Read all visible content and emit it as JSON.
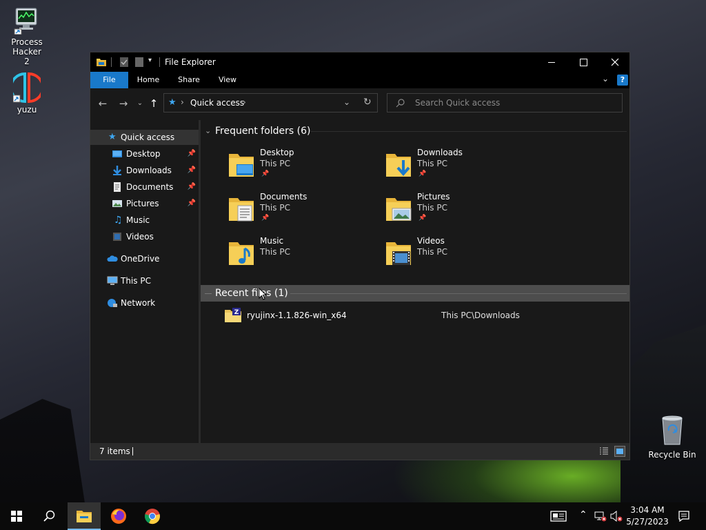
{
  "desktop": {
    "icons": [
      {
        "label": "Process Hacker 2"
      },
      {
        "label": "yuzu"
      },
      {
        "label": "Recycle Bin"
      }
    ]
  },
  "window": {
    "title": "File Explorer",
    "ribbon_tabs": [
      "File",
      "Home",
      "Share",
      "View"
    ],
    "address": {
      "location": "Quick access"
    },
    "search": {
      "placeholder": "Search Quick access"
    },
    "sidebar": [
      {
        "label": "Quick access",
        "icon": "star-icon",
        "pinned": false
      },
      {
        "label": "Desktop",
        "icon": "desktop-folder-icon",
        "pinned": true
      },
      {
        "label": "Downloads",
        "icon": "download-arrow-icon",
        "pinned": true
      },
      {
        "label": "Documents",
        "icon": "document-icon",
        "pinned": true
      },
      {
        "label": "Pictures",
        "icon": "pictures-icon",
        "pinned": true
      },
      {
        "label": "Music",
        "icon": "music-note-icon",
        "pinned": false
      },
      {
        "label": "Videos",
        "icon": "film-icon",
        "pinned": false
      },
      {
        "label": "OneDrive",
        "icon": "cloud-icon",
        "pinned": false
      },
      {
        "label": "This PC",
        "icon": "computer-icon",
        "pinned": false
      },
      {
        "label": "Network",
        "icon": "network-icon",
        "pinned": false
      }
    ],
    "frequent": {
      "header": "Frequent folders (6)",
      "folders": [
        {
          "name": "Desktop",
          "location": "This PC",
          "pinned": true
        },
        {
          "name": "Downloads",
          "location": "This PC",
          "pinned": true
        },
        {
          "name": "Documents",
          "location": "This PC",
          "pinned": true
        },
        {
          "name": "Pictures",
          "location": "This PC",
          "pinned": true
        },
        {
          "name": "Music",
          "location": "This PC",
          "pinned": false
        },
        {
          "name": "Videos",
          "location": "This PC",
          "pinned": false
        }
      ]
    },
    "recent": {
      "header": "Recent files (1)",
      "files": [
        {
          "name": "ryujinx-1.1.826-win_x64",
          "path": "This PC\\Downloads"
        }
      ]
    },
    "status": {
      "items": "7 items"
    }
  },
  "taskbar": {
    "clock": {
      "time": "3:04 AM",
      "date": "5/27/2023"
    }
  },
  "colors": {
    "accent": "#1979ca",
    "folder": "#f2c94c",
    "background": "#191919"
  }
}
